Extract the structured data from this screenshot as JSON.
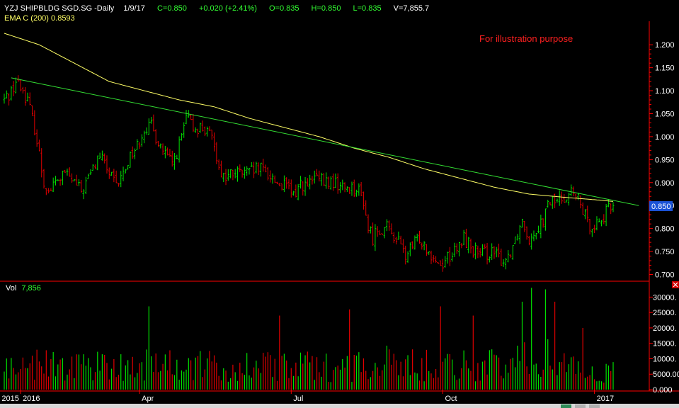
{
  "header": {
    "symbol": "YZJ SHIPBLDG SGD.SG -Daily",
    "date": "1/9/17",
    "close": "C=0.850",
    "change": "+0.020 (+2.41%)",
    "open": "O=0.835",
    "high": "H=0.850",
    "low": "L=0.835",
    "volume": "V=7,855.7",
    "ema_label": "EMA C (200) 0.8593"
  },
  "annotation": "For illustration purpose",
  "volume_pane": {
    "label": "Vol",
    "value": "7,856"
  },
  "last_price_badge": "0.850",
  "colors": {
    "background": "#000000",
    "up": "#00e000",
    "down": "#e00000",
    "ema": "#ffff66",
    "trendline": "#33dd33",
    "axis": "#ff0000",
    "annotation": "#ff2020",
    "badge": "#1a52d6",
    "header_label": "#ffffff",
    "header_green": "#33ff33",
    "ema_label": "#ffff66"
  },
  "chart_data": {
    "type": "candlestick",
    "price_axis": {
      "ylim": [
        0.69,
        1.245
      ],
      "ticks": [
        "1.200",
        "1.150",
        "1.100",
        "1.050",
        "1.000",
        "0.950",
        "0.900",
        "0.850",
        "0.800",
        "0.750",
        "0.700"
      ]
    },
    "volume_axis": {
      "ylim": [
        0,
        34000
      ],
      "ticks": [
        "30000.",
        "25000.",
        "20000.",
        "15000.",
        "10000.",
        "5000.00",
        "0.000"
      ]
    },
    "date_labels": [
      "2015",
      "2016",
      "Apr",
      "Jul",
      "Oct",
      "2017"
    ],
    "date_positions": [
      -2,
      7,
      58,
      123,
      188,
      253
    ],
    "bar_count": 262,
    "close_keypoints": [
      [
        0,
        1.08
      ],
      [
        3,
        1.1
      ],
      [
        5,
        1.12
      ],
      [
        8,
        1.1
      ],
      [
        10,
        1.08
      ],
      [
        13,
        1.02
      ],
      [
        17,
        0.9
      ],
      [
        19,
        0.88
      ],
      [
        22,
        0.9
      ],
      [
        26,
        0.92
      ],
      [
        30,
        0.9
      ],
      [
        33,
        0.88
      ],
      [
        37,
        0.92
      ],
      [
        41,
        0.96
      ],
      [
        45,
        0.92
      ],
      [
        48,
        0.89
      ],
      [
        51,
        0.92
      ],
      [
        54,
        0.96
      ],
      [
        57,
        0.98
      ],
      [
        60,
        1.02
      ],
      [
        63,
        1.02
      ],
      [
        66,
        0.99
      ],
      [
        69,
        0.96
      ],
      [
        72,
        0.94
      ],
      [
        75,
        0.98
      ],
      [
        78,
        1.04
      ],
      [
        81,
        1.02
      ],
      [
        85,
        1.02
      ],
      [
        88,
        1.0
      ],
      [
        90,
        0.99
      ],
      [
        92,
        0.93
      ],
      [
        95,
        0.91
      ],
      [
        98,
        0.92
      ],
      [
        101,
        0.92
      ],
      [
        105,
        0.92
      ],
      [
        109,
        0.93
      ],
      [
        113,
        0.92
      ],
      [
        117,
        0.9
      ],
      [
        121,
        0.89
      ],
      [
        124,
        0.87
      ],
      [
        127,
        0.9
      ],
      [
        130,
        0.89
      ],
      [
        133,
        0.91
      ],
      [
        137,
        0.9
      ],
      [
        141,
        0.9
      ],
      [
        145,
        0.89
      ],
      [
        149,
        0.89
      ],
      [
        152,
        0.88
      ],
      [
        154,
        0.86
      ],
      [
        156,
        0.8
      ],
      [
        158,
        0.78
      ],
      [
        160,
        0.8
      ],
      [
        164,
        0.8
      ],
      [
        168,
        0.78
      ],
      [
        172,
        0.74
      ],
      [
        175,
        0.76
      ],
      [
        178,
        0.78
      ],
      [
        181,
        0.76
      ],
      [
        184,
        0.74
      ],
      [
        187,
        0.72
      ],
      [
        190,
        0.74
      ],
      [
        194,
        0.75
      ],
      [
        197,
        0.78
      ],
      [
        200,
        0.76
      ],
      [
        204,
        0.74
      ],
      [
        208,
        0.75
      ],
      [
        211,
        0.74
      ],
      [
        214,
        0.73
      ],
      [
        216,
        0.74
      ],
      [
        219,
        0.78
      ],
      [
        222,
        0.82
      ],
      [
        225,
        0.78
      ],
      [
        228,
        0.8
      ],
      [
        231,
        0.82
      ],
      [
        234,
        0.86
      ],
      [
        237,
        0.86
      ],
      [
        240,
        0.87
      ],
      [
        243,
        0.88
      ],
      [
        246,
        0.86
      ],
      [
        248,
        0.84
      ],
      [
        250,
        0.81
      ],
      [
        253,
        0.81
      ],
      [
        256,
        0.82
      ],
      [
        259,
        0.84
      ],
      [
        261,
        0.85
      ]
    ],
    "ema200_keypoints": [
      [
        0,
        1.225
      ],
      [
        15,
        1.2
      ],
      [
        30,
        1.16
      ],
      [
        45,
        1.12
      ],
      [
        60,
        1.1
      ],
      [
        75,
        1.08
      ],
      [
        90,
        1.065
      ],
      [
        105,
        1.04
      ],
      [
        120,
        1.02
      ],
      [
        135,
        1.0
      ],
      [
        150,
        0.975
      ],
      [
        165,
        0.955
      ],
      [
        180,
        0.93
      ],
      [
        195,
        0.91
      ],
      [
        210,
        0.89
      ],
      [
        225,
        0.875
      ],
      [
        240,
        0.868
      ],
      [
        255,
        0.862
      ],
      [
        261,
        0.859
      ]
    ],
    "trendline": {
      "start": [
        3,
        1.128
      ],
      "end": [
        272,
        0.85
      ]
    },
    "volume_envelope": [
      [
        0,
        9000
      ],
      [
        20,
        10500
      ],
      [
        40,
        10000
      ],
      [
        60,
        10500
      ],
      [
        80,
        9500
      ],
      [
        100,
        9000
      ],
      [
        120,
        9500
      ],
      [
        140,
        9000
      ],
      [
        160,
        11000
      ],
      [
        180,
        10000
      ],
      [
        200,
        10000
      ],
      [
        215,
        9500
      ],
      [
        225,
        14000
      ],
      [
        240,
        12000
      ],
      [
        255,
        6500
      ],
      [
        261,
        8000
      ]
    ],
    "volume_spikes": [
      [
        62,
        27000
      ],
      [
        118,
        24000
      ],
      [
        148,
        26000
      ],
      [
        187,
        27000
      ],
      [
        201,
        24000
      ],
      [
        222,
        28500
      ],
      [
        226,
        33000
      ],
      [
        232,
        32500
      ],
      [
        236,
        28500
      ],
      [
        248,
        20000
      ]
    ],
    "last_close": 0.85
  }
}
